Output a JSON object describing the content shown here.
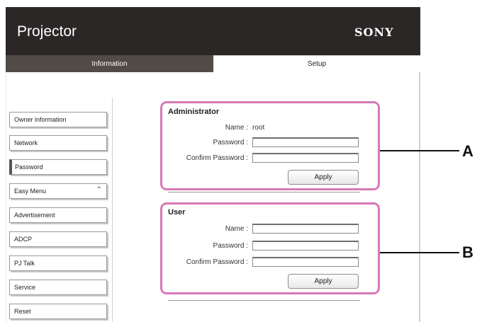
{
  "app": {
    "title": "Projector",
    "brand": "SONY"
  },
  "tabs": [
    {
      "label": "Information"
    },
    {
      "label": "Setup"
    }
  ],
  "sidebar": {
    "items": [
      {
        "label": "Owner information"
      },
      {
        "label": "Network"
      },
      {
        "label": "Password"
      },
      {
        "label": "Easy Menu"
      },
      {
        "label": "Advertisement"
      },
      {
        "label": "ADCP"
      },
      {
        "label": "PJ Talk"
      },
      {
        "label": "Service"
      },
      {
        "label": "Reset"
      }
    ]
  },
  "administrator": {
    "title": "Administrator",
    "name_label": "Name :",
    "name_value": "root",
    "password_label": "Password :",
    "confirm_label": "Confirm Password :",
    "apply_label": "Apply"
  },
  "user": {
    "title": "User",
    "name_label": "Name :",
    "password_label": "Password :",
    "confirm_label": "Confirm Password :",
    "apply_label": "Apply"
  },
  "callouts": {
    "a": "A",
    "b": "B"
  },
  "colors": {
    "header": "#2b2726",
    "active_tab": "#514a46",
    "highlight": "#d678b5"
  }
}
